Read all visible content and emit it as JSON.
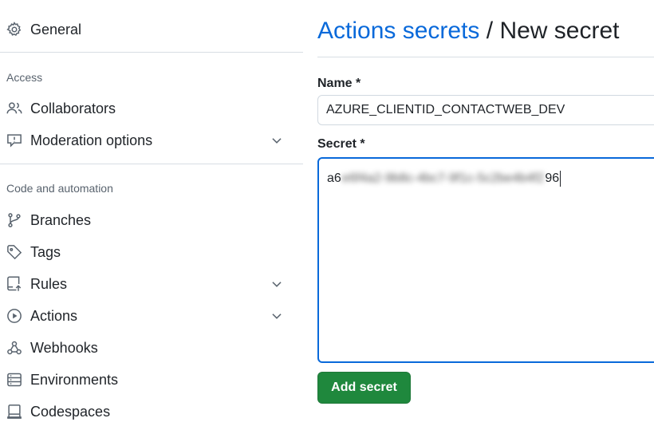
{
  "sidebar": {
    "general": {
      "label": "General",
      "icon": "gear-icon"
    },
    "sections": [
      {
        "heading": "Access"
      },
      {
        "heading": "Code and automation"
      }
    ],
    "items": [
      {
        "label": "Collaborators",
        "icon": "people-icon"
      },
      {
        "label": "Moderation options",
        "icon": "report-icon",
        "expandable": true
      },
      {
        "label": "Branches",
        "icon": "git-branch-icon"
      },
      {
        "label": "Tags",
        "icon": "tag-icon"
      },
      {
        "label": "Rules",
        "icon": "repo-push-icon",
        "expandable": true
      },
      {
        "label": "Actions",
        "icon": "play-icon",
        "expandable": true
      },
      {
        "label": "Webhooks",
        "icon": "webhook-icon"
      },
      {
        "label": "Environments",
        "icon": "server-icon"
      },
      {
        "label": "Codespaces",
        "icon": "codespaces-icon"
      }
    ]
  },
  "main": {
    "breadcrumb_link": "Actions secrets",
    "breadcrumb_sep": " / ",
    "title": "New secret",
    "name_label": "Name *",
    "name_value": "AZURE_CLIENTID_CONTACTWEB_DEV",
    "secret_label": "Secret *",
    "secret_prefix": "a6",
    "secret_suffix": "96",
    "submit_label": "Add secret"
  },
  "colors": {
    "link": "#0969da",
    "primary_button": "#1f883d",
    "focus_border": "#0969da"
  }
}
